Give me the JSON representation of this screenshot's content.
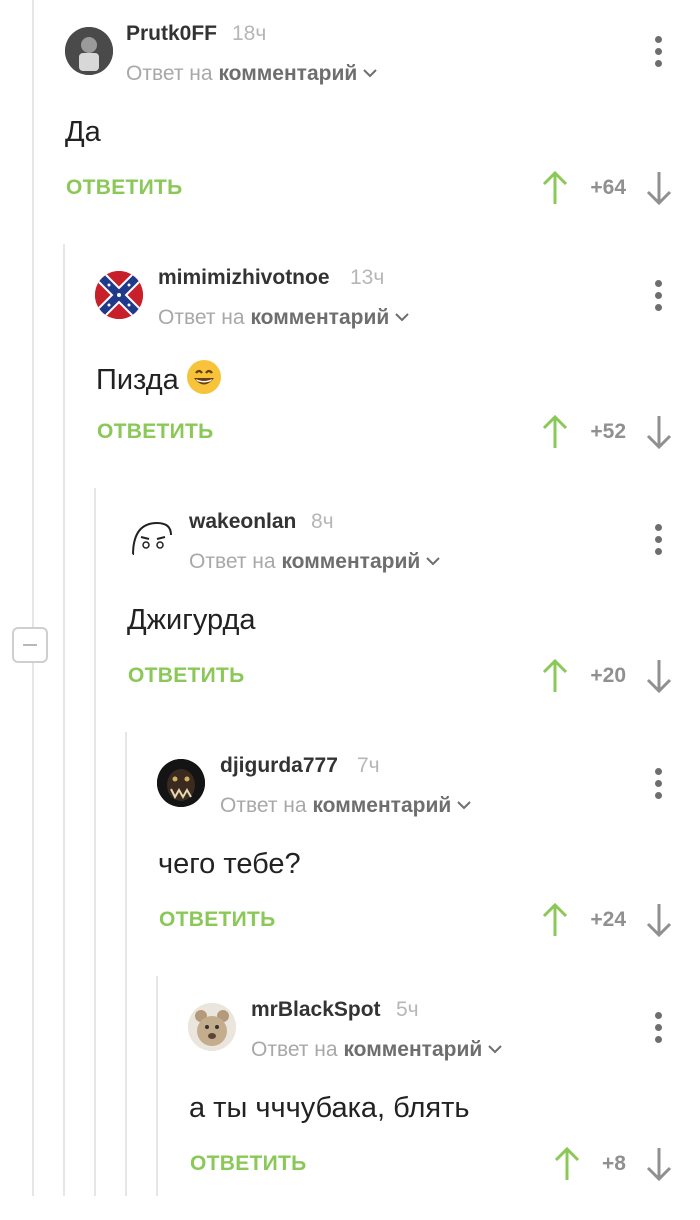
{
  "labels": {
    "reply_to_prefix": "Ответ на",
    "reply_to_target": "комментарий",
    "reply_button": "ОТВЕТИТЬ"
  },
  "colors": {
    "reply_green": "#8ac858",
    "vote_up_green": "#8ac858",
    "vote_gray": "#909090"
  },
  "comments": [
    {
      "author": "Prutk0FF",
      "time": "18ч",
      "text": "Да",
      "rating": "+64",
      "avatar_icon": "photo-avatar"
    },
    {
      "author": "mimimizhivotnoe",
      "time": "13ч",
      "text": "Пизда",
      "rating": "+52",
      "avatar_icon": "confederate-flag-avatar",
      "emoji": "grinning-smile-emoji"
    },
    {
      "author": "wakeonlan",
      "time": "8ч",
      "text": "Джигурда",
      "rating": "+20",
      "avatar_icon": "cartoon-face-avatar"
    },
    {
      "author": "djigurda777",
      "time": "7ч",
      "text": "чего тебе?",
      "rating": "+24",
      "avatar_icon": "dark-monster-avatar"
    },
    {
      "author": "mrBlackSpot",
      "time": "5ч",
      "text": "а ты чччубака, блять",
      "rating": "+8",
      "avatar_icon": "bear-avatar"
    }
  ]
}
